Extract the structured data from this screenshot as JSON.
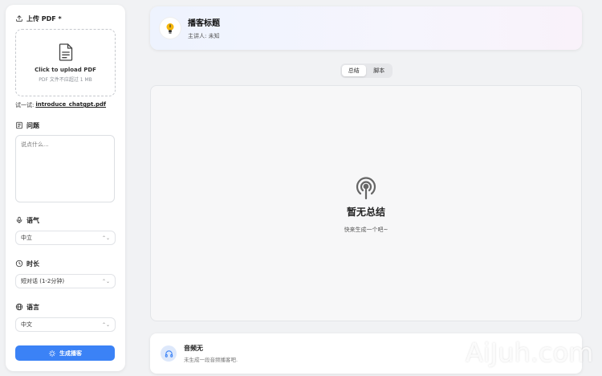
{
  "sidebar": {
    "upload": {
      "label": "上传 PDF *",
      "title": "Click to upload PDF",
      "hint": "PDF 文件不应超过 1 MB"
    },
    "try": {
      "prefix": "试一试:",
      "file": "introduce_chatgpt.pdf"
    },
    "question": {
      "label": "问题",
      "placeholder": "说点什么..."
    },
    "tone": {
      "label": "语气",
      "value": "中立"
    },
    "duration": {
      "label": "时长",
      "value": "短对话 (1-2分钟)"
    },
    "language": {
      "label": "语言",
      "value": "中文"
    },
    "generate_label": "生成播客"
  },
  "header": {
    "title": "播客标题",
    "speaker": "主讲人: 未知"
  },
  "tabs": [
    {
      "label": "总结",
      "active": true
    },
    {
      "label": "脚本",
      "active": false
    }
  ],
  "empty": {
    "title": "暂无总结",
    "subtitle": "快来生成一个吧~"
  },
  "audio": {
    "title": "音频无",
    "subtitle": "未生成一段音频播客吧."
  },
  "watermark": "AiJuh.com",
  "colors": {
    "accent": "#3b82f6",
    "page_bg": "#f1f2f4"
  },
  "icons": {
    "upload": "upload-icon",
    "question": "document-icon",
    "tone": "microphone-icon",
    "duration": "clock-icon",
    "language": "globe-icon",
    "generate": "sparkle-icon",
    "empty": "podcast-icon",
    "audio": "headphones-icon"
  }
}
